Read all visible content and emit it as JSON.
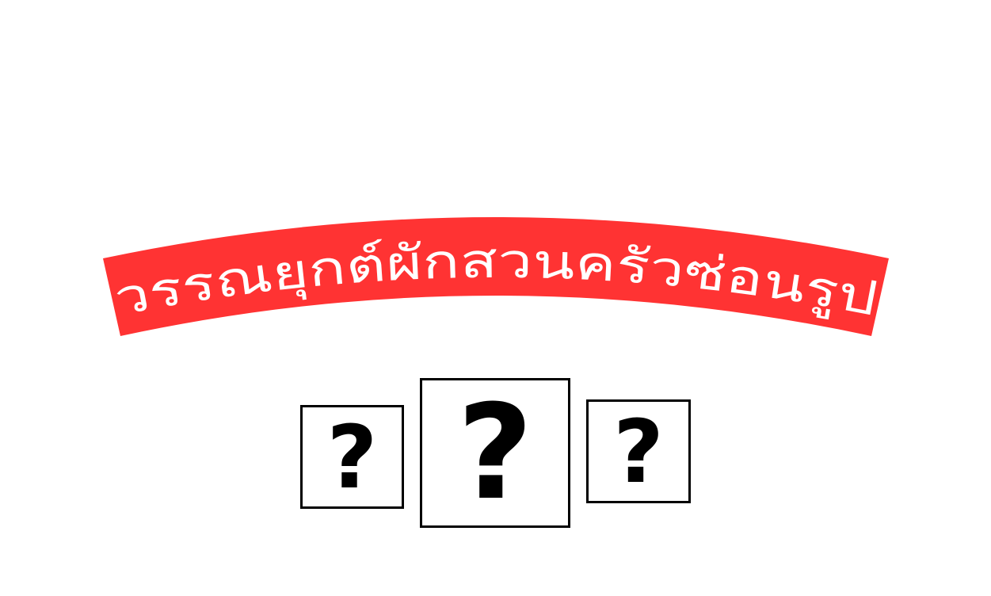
{
  "banner": {
    "title": "วรรณยุกต์ผักสวนครัวซ่อนรูป",
    "color": "#ff3333",
    "text_color": "#ffffff"
  },
  "cards": [
    {
      "symbol": "?",
      "icon": "question-mark-icon"
    },
    {
      "symbol": "?",
      "icon": "question-mark-icon"
    },
    {
      "symbol": "?",
      "icon": "question-mark-icon"
    }
  ]
}
